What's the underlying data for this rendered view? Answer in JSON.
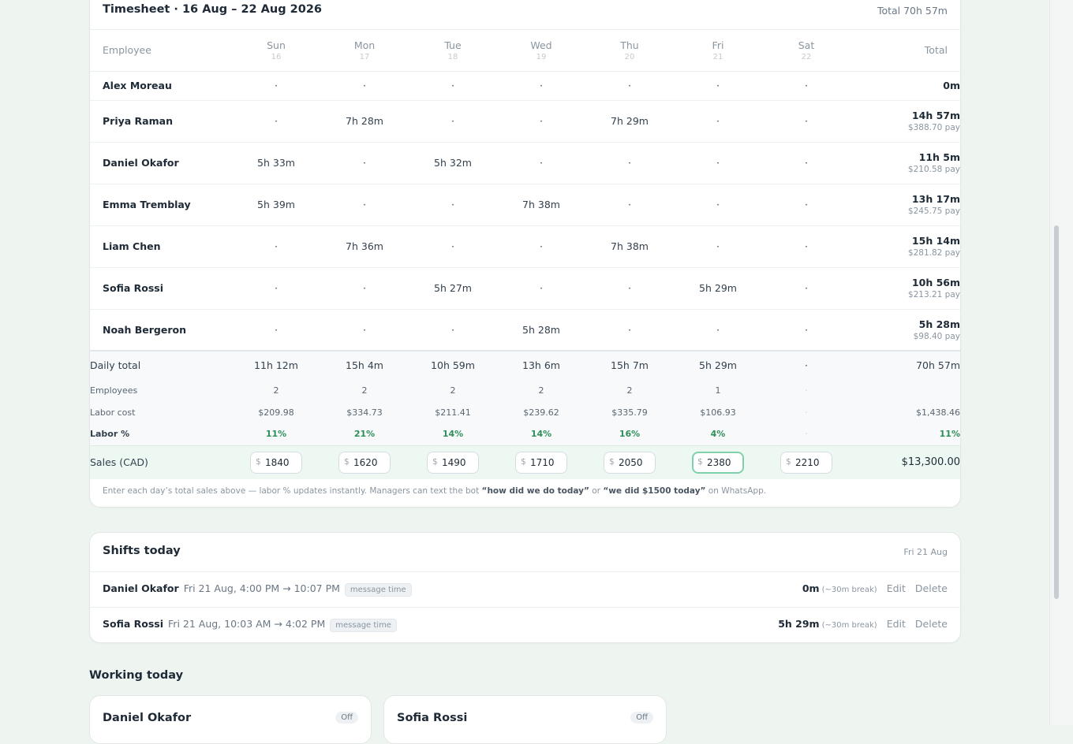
{
  "timesheet": {
    "title": "Timesheet · 16 Aug – 22 Aug 2026",
    "total": "Total 70h 57m",
    "employee_header": "Employee",
    "total_header": "Total",
    "days": [
      {
        "name": "Sun",
        "num": "16"
      },
      {
        "name": "Mon",
        "num": "17"
      },
      {
        "name": "Tue",
        "num": "18"
      },
      {
        "name": "Wed",
        "num": "19"
      },
      {
        "name": "Thu",
        "num": "20"
      },
      {
        "name": "Fri",
        "num": "21"
      },
      {
        "name": "Sat",
        "num": "22"
      }
    ],
    "rows": [
      {
        "name": "Alex Moreau",
        "days": [
          "·",
          "·",
          "·",
          "·",
          "·",
          "·",
          "·"
        ],
        "total": "0m",
        "pay": ""
      },
      {
        "name": "Priya Raman",
        "days": [
          "·",
          "7h 28m",
          "·",
          "·",
          "7h 29m",
          "·",
          "·"
        ],
        "total": "14h 57m",
        "pay": "$388.70 pay"
      },
      {
        "name": "Daniel Okafor",
        "days": [
          "5h 33m",
          "·",
          "5h 32m",
          "·",
          "·",
          "·",
          "·"
        ],
        "total": "11h 5m",
        "pay": "$210.58 pay"
      },
      {
        "name": "Emma Tremblay",
        "days": [
          "5h 39m",
          "·",
          "·",
          "7h 38m",
          "·",
          "·",
          "·"
        ],
        "total": "13h 17m",
        "pay": "$245.75 pay"
      },
      {
        "name": "Liam Chen",
        "days": [
          "·",
          "7h 36m",
          "·",
          "·",
          "7h 38m",
          "·",
          "·"
        ],
        "total": "15h 14m",
        "pay": "$281.82 pay"
      },
      {
        "name": "Sofia Rossi",
        "days": [
          "·",
          "·",
          "5h 27m",
          "·",
          "·",
          "5h 29m",
          "·"
        ],
        "total": "10h 56m",
        "pay": "$213.21 pay"
      },
      {
        "name": "Noah Bergeron",
        "days": [
          "·",
          "·",
          "·",
          "5h 28m",
          "·",
          "·",
          "·"
        ],
        "total": "5h 28m",
        "pay": "$98.40 pay"
      }
    ],
    "summary": {
      "daily": {
        "label": "Daily total",
        "values": [
          "11h 12m",
          "15h 4m",
          "10h 59m",
          "13h 6m",
          "15h 7m",
          "5h 29m",
          "·"
        ],
        "total": "70h 57m"
      },
      "employees": {
        "label": "Employees",
        "values": [
          "2",
          "2",
          "2",
          "2",
          "2",
          "1",
          "·"
        ],
        "total": ""
      },
      "labor_cost": {
        "label": "Labor cost",
        "values": [
          "$209.98",
          "$334.73",
          "$211.41",
          "$239.62",
          "$335.79",
          "$106.93",
          "·"
        ],
        "total": "$1,438.46"
      },
      "labor_pct": {
        "label": "Labor %",
        "values": [
          "11%",
          "21%",
          "14%",
          "14%",
          "16%",
          "4%",
          "·"
        ],
        "total": "11%"
      }
    },
    "sales": {
      "label": "Sales (CAD)",
      "currency": "$",
      "values": [
        "1840",
        "1620",
        "1490",
        "1710",
        "2050",
        "2380",
        "2210"
      ],
      "active_index": 5,
      "total": "$13,300.00"
    },
    "note": {
      "part1": "Enter each day’s total sales above — labor % updates instantly. Managers can text the bot ",
      "q1": "“how did we do today”",
      "part2": " or ",
      "q2": "“we did $1500 today”",
      "part3": " on WhatsApp."
    }
  },
  "shifts": {
    "title": "Shifts today",
    "date": "Fri 21 Aug",
    "items": [
      {
        "name": "Daniel Okafor",
        "time": "Fri 21 Aug, 4:00 PM → 10:07 PM",
        "tag": "message time",
        "duration": "0m",
        "break": "(~30m break)",
        "edit": "Edit",
        "delete": "Delete"
      },
      {
        "name": "Sofia Rossi",
        "time": "Fri 21 Aug, 10:03 AM → 4:02 PM",
        "tag": "message time",
        "duration": "5h 29m",
        "break": "(~30m break)",
        "edit": "Edit",
        "delete": "Delete"
      }
    ]
  },
  "working_today": {
    "title": "Working today",
    "cards": [
      {
        "name": "Daniel Okafor",
        "status": "Off"
      },
      {
        "name": "Sofia Rossi",
        "status": "Off"
      }
    ]
  },
  "colors": {
    "background": "#eef5f1",
    "accent_green": "#2f8f5a",
    "sales_row_bg": "#eef8f3",
    "active_input_border": "#7fd1ac"
  }
}
